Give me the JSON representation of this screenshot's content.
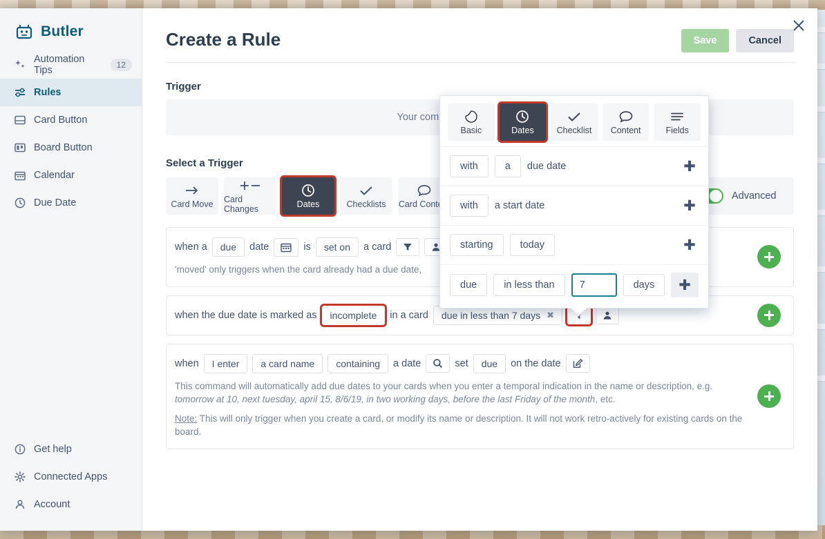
{
  "app": {
    "brand": "Butler",
    "logo_icon": "robot-icon"
  },
  "sidebar": {
    "items": [
      {
        "label": "Automation Tips",
        "icon": "sparkles-icon",
        "badge": "12"
      },
      {
        "label": "Rules",
        "icon": "sliders-icon"
      },
      {
        "label": "Card Button",
        "icon": "card-button-icon"
      },
      {
        "label": "Board Button",
        "icon": "board-button-icon"
      },
      {
        "label": "Calendar",
        "icon": "calendar-icon"
      },
      {
        "label": "Due Date",
        "icon": "clock-icon"
      }
    ],
    "bottom_items": [
      {
        "label": "Get help",
        "icon": "info-icon"
      },
      {
        "label": "Connected Apps",
        "icon": "gear-icon"
      },
      {
        "label": "Account",
        "icon": "person-icon"
      }
    ]
  },
  "header": {
    "title": "Create a Rule",
    "save_label": "Save",
    "cancel_label": "Cancel",
    "close_icon": "close-icon"
  },
  "trigger_section": {
    "label": "Trigger",
    "empty_message": "Your command doesn't have a trigger"
  },
  "select_trigger": {
    "label": "Select a Trigger",
    "categories": [
      {
        "label": "Card Move",
        "icon": "arrow-right-icon",
        "selected": false
      },
      {
        "label": "Card Changes",
        "icon": "plus-minus-icon",
        "selected": false
      },
      {
        "label": "Dates",
        "icon": "clock-icon",
        "selected": true
      },
      {
        "label": "Checklists",
        "icon": "check-icon",
        "selected": false
      },
      {
        "label": "Card Content",
        "icon": "comment-icon",
        "selected": false
      }
    ],
    "advanced_label": "Advanced",
    "advanced_on": true
  },
  "rules": [
    {
      "parts": [
        {
          "type": "text",
          "text": "when a"
        },
        {
          "type": "chip",
          "text": "due"
        },
        {
          "type": "text",
          "text": "date"
        },
        {
          "type": "icon",
          "icon": "calendar-icon"
        },
        {
          "type": "text",
          "text": "is"
        },
        {
          "type": "chip",
          "text": "set on"
        },
        {
          "type": "text",
          "text": "a card"
        },
        {
          "type": "icon",
          "icon": "filter-icon"
        },
        {
          "type": "icon",
          "icon": "person-icon"
        }
      ],
      "hint": "'moved' only triggers when the card already had a due date,",
      "add_icon": "plus-circle-icon"
    },
    {
      "parts": [
        {
          "type": "text",
          "text": "when the due date is marked as"
        },
        {
          "type": "chip",
          "text": "incomplete",
          "highlighted": true
        },
        {
          "type": "text",
          "text": "in a card"
        },
        {
          "type": "token",
          "text": "due in less than 7 days",
          "remove_icon": "x-icon"
        },
        {
          "type": "icon",
          "icon": "filter-icon",
          "highlighted": true
        },
        {
          "type": "icon",
          "icon": "person-icon"
        }
      ],
      "add_icon": "plus-circle-icon"
    },
    {
      "parts": [
        {
          "type": "text",
          "text": "when"
        },
        {
          "type": "chip",
          "text": "I enter"
        },
        {
          "type": "chip",
          "text": "a card name"
        },
        {
          "type": "chip",
          "text": "containing"
        },
        {
          "type": "text",
          "text": "a date"
        },
        {
          "type": "icon",
          "icon": "search-icon"
        },
        {
          "type": "text",
          "text": "set"
        },
        {
          "type": "chip",
          "text": "due"
        },
        {
          "type": "text",
          "text": "on the date"
        },
        {
          "type": "icon",
          "icon": "edit-icon"
        }
      ],
      "hint_html": [
        "This command will automatically add due dates to your cards when you enter a temporal indication in the name or description, e.g. ",
        "tomorrow at 10, next tuesday, april 15, 8/6/19, in two working days, before the last Friday of the month",
        ", etc."
      ],
      "note_label": "Note:",
      "note_text": " This will only trigger when you create a card, or modify its name or description. It will not work retro-actively for existing cards on the board.",
      "add_icon": "plus-circle-icon"
    }
  ],
  "popup": {
    "tabs": [
      {
        "label": "Basic",
        "icon": "tag-icon",
        "selected": false
      },
      {
        "label": "Dates",
        "icon": "clock-icon",
        "selected": true
      },
      {
        "label": "Checklist",
        "icon": "check-icon",
        "selected": false
      },
      {
        "label": "Content",
        "icon": "comment-icon",
        "selected": false
      },
      {
        "label": "Fields",
        "icon": "lines-icon",
        "selected": false
      }
    ],
    "rows": [
      {
        "chips": [
          "with",
          "a"
        ],
        "text": "due date",
        "add_icon": "plus-icon",
        "add_boxed": false
      },
      {
        "chips": [
          "with"
        ],
        "text": "a start date",
        "add_icon": "plus-icon",
        "add_boxed": false
      },
      {
        "chips": [
          "starting",
          "today"
        ],
        "text": "",
        "add_icon": "plus-icon",
        "add_boxed": false
      },
      {
        "chips": [
          "due",
          "in less than"
        ],
        "input_value": "7",
        "trailing_chip": "days",
        "add_icon": "plus-icon",
        "add_boxed": true
      }
    ]
  },
  "colors": {
    "brand_teal": "#0f5c75",
    "accent_green": "#4caf50",
    "save_green": "#a5d6a1",
    "highlight_red": "#c0392b",
    "selected_dark": "#3e4552",
    "focus_teal": "#1b7f8e"
  }
}
